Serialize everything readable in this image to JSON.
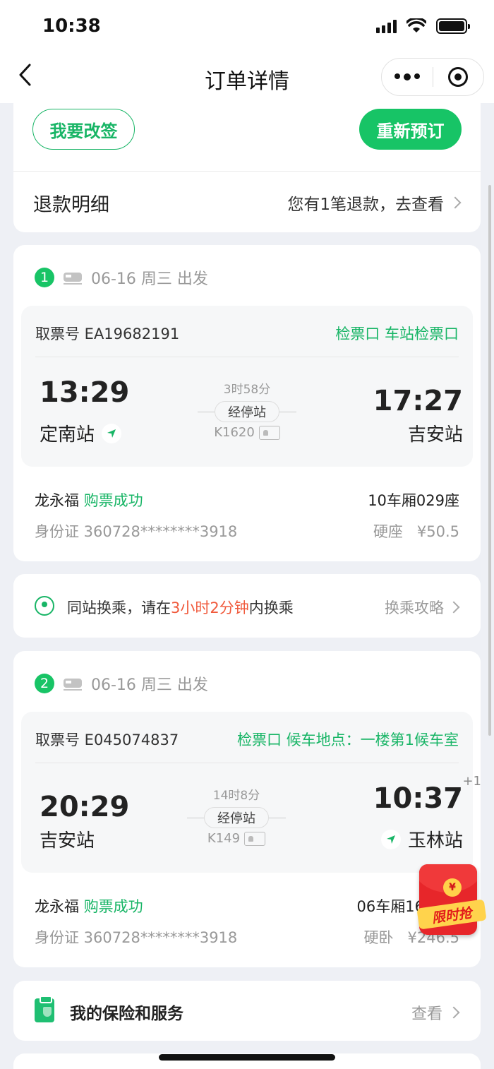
{
  "status_bar": {
    "time": "10:38"
  },
  "nav": {
    "title": "订单详情"
  },
  "actions": {
    "change_label": "我要改签",
    "rebook_label": "重新预订"
  },
  "refund": {
    "label": "退款明细",
    "link": "您有1笔退款，去查看"
  },
  "trips": [
    {
      "index": "1",
      "date": "06-16 周三 出发",
      "ticket_no": "取票号 EA19682191",
      "gate": "检票口 车站检票口",
      "dep_time": "13:29",
      "dep_station": "定南站",
      "duration": "3时58分",
      "via": "经停站",
      "train_no": "K1620",
      "arr_time": "17:27",
      "arr_station": "吉安站",
      "arr_day_offset": "",
      "passenger": "龙永福",
      "status": "购票成功",
      "seat": "10车厢029座",
      "id_card": "身份证 360728********3918",
      "price": "硬座   ¥50.5"
    },
    {
      "index": "2",
      "date": "06-16 周三 出发",
      "ticket_no": "取票号 E045074837",
      "gate": "检票口 候车地点：一楼第1候车室",
      "dep_time": "20:29",
      "dep_station": "吉安站",
      "duration": "14时8分",
      "via": "经停站",
      "train_no": "K149",
      "arr_time": "10:37",
      "arr_station": "玉林站",
      "arr_day_offset": "+1",
      "passenger": "龙永福",
      "status": "购票成功",
      "seat": "06车厢16",
      "id_card": "身份证 360728********3918",
      "price": "硬卧   ¥246.5"
    }
  ],
  "transfer": {
    "prefix": "同站换乘，请在",
    "highlight": "3小时2分钟",
    "suffix": "内换乘",
    "link": "换乘攻略"
  },
  "insurance": {
    "label": "我的保险和服务",
    "link": "查看"
  },
  "promo": {
    "label": "限时抢",
    "coin": "¥"
  },
  "colors": {
    "accent": "#18b566",
    "highlight": "#f05a3c",
    "promo": "#e7262a"
  }
}
